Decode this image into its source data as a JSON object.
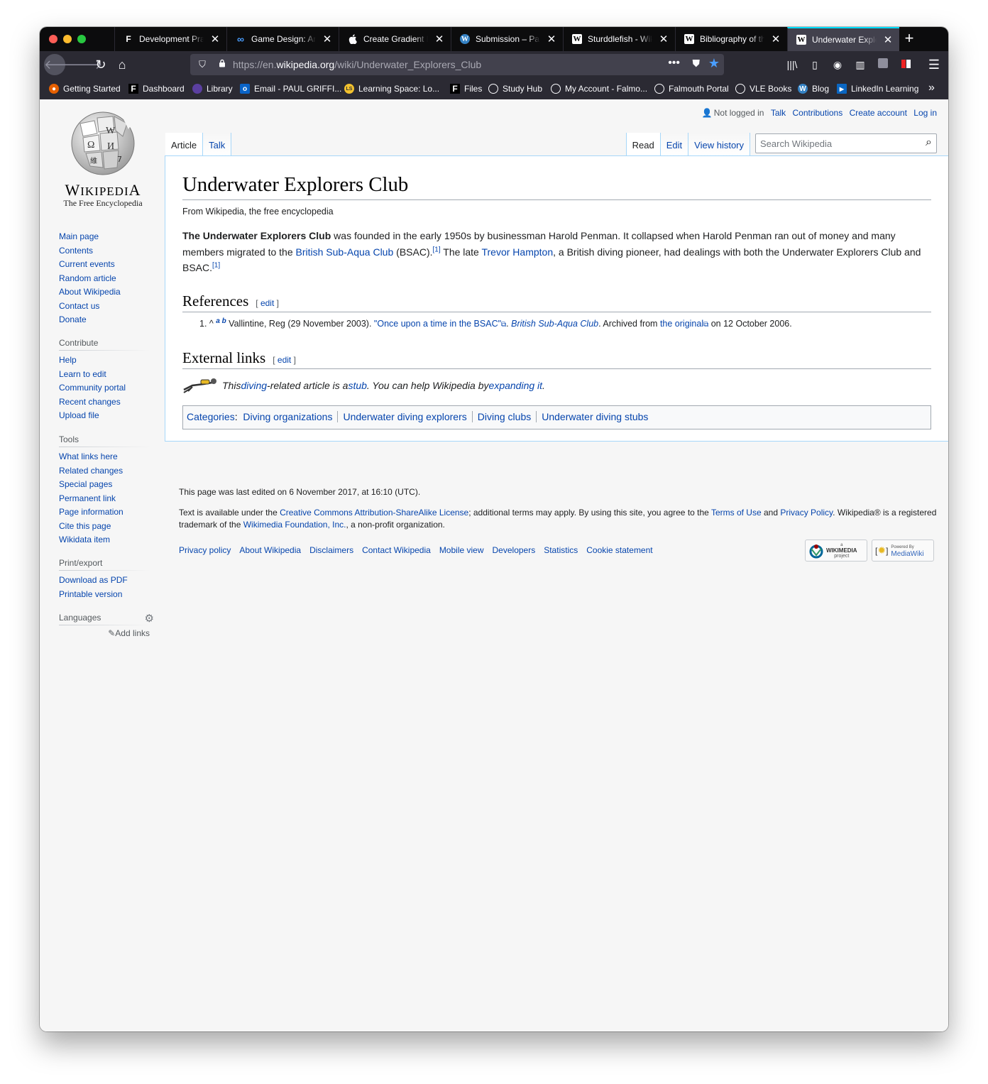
{
  "browser": {
    "tabs": [
      {
        "label": "Development Practice",
        "icon": "falmouth-f-icon"
      },
      {
        "label": "Game Design: Art & Concept",
        "icon": "infinity-icon"
      },
      {
        "label": "Create Gradient Fills",
        "icon": "apple-icon"
      },
      {
        "label": "Submission – Paul",
        "icon": "wordpress-icon"
      },
      {
        "label": "Sturddlefish - Wiki",
        "icon": "wikipedia-w-icon"
      },
      {
        "label": "Bibliography of the",
        "icon": "wikipedia-w-icon"
      },
      {
        "label": "Underwater Explorers",
        "icon": "wikipedia-w-icon",
        "active": true
      }
    ],
    "url_prefix": "https://en.",
    "url_domain": "wikipedia.org",
    "url_path": "/wiki/Underwater_Explorers_Club",
    "bookmarks": [
      {
        "label": "Getting Started",
        "icon": "firefox-icon",
        "color": "#e66000"
      },
      {
        "label": "Dashboard",
        "icon": "falmouth-f-icon",
        "color": "#000000"
      },
      {
        "label": "Library",
        "icon": "library-icon",
        "color": "#5b3fa0"
      },
      {
        "label": "Email - PAUL GRIFFI...",
        "icon": "outlook-icon",
        "color": "#0a64c8"
      },
      {
        "label": "Learning Space: Lo...",
        "icon": "ls-icon",
        "color": "#f2c12e"
      },
      {
        "label": "Files",
        "icon": "falmouth-f-icon",
        "color": "#000000"
      },
      {
        "label": "Study Hub",
        "icon": "globe-icon",
        "color": "#2b2a33"
      },
      {
        "label": "My Account - Falmo...",
        "icon": "globe-icon",
        "color": "#2b2a33"
      },
      {
        "label": "Falmouth Portal",
        "icon": "globe-icon",
        "color": "#2b2a33"
      },
      {
        "label": "VLE Books",
        "icon": "globe-icon",
        "color": "#2b2a33"
      },
      {
        "label": "Blog",
        "icon": "wordpress-icon",
        "color": "#3582c4"
      },
      {
        "label": "LinkedIn Learning",
        "icon": "linkedin-learning-icon",
        "color": "#0a66c2"
      }
    ]
  },
  "logo": {
    "wordmark": "Wikipedia",
    "tagline": "The Free Encyclopedia"
  },
  "sidebar": {
    "navigation": [
      "Main page",
      "Contents",
      "Current events",
      "Random article",
      "About Wikipedia",
      "Contact us",
      "Donate"
    ],
    "contribute": {
      "heading": "Contribute",
      "items": [
        "Help",
        "Learn to edit",
        "Community portal",
        "Recent changes",
        "Upload file"
      ]
    },
    "tools": {
      "heading": "Tools",
      "items": [
        "What links here",
        "Related changes",
        "Special pages",
        "Permanent link",
        "Page information",
        "Cite this page",
        "Wikidata item"
      ]
    },
    "print": {
      "heading": "Print/export",
      "items": [
        "Download as PDF",
        "Printable version"
      ]
    },
    "languages": {
      "heading": "Languages",
      "add_links": "Add links"
    }
  },
  "personal": {
    "not_logged_in": "Not logged in",
    "talk": "Talk",
    "contributions": "Contributions",
    "create_account": "Create account",
    "log_in": "Log in"
  },
  "tabs": {
    "article": "Article",
    "talk": "Talk",
    "read": "Read",
    "edit": "Edit",
    "view_history": "View history"
  },
  "search": {
    "placeholder": "Search Wikipedia"
  },
  "article": {
    "title": "Underwater Explorers Club",
    "site_sub": "From Wikipedia, the free encyclopedia",
    "p_bold": "The Underwater Explorers Club",
    "p_t1": " was founded in the early 1950s by businessman Harold Penman. It collapsed when Harold Penman ran out of money and many members migrated to the ",
    "p_link1": "British Sub-Aqua Club",
    "p_t2": " (BSAC).",
    "p_sup1": "[1]",
    "p_t3": " The late ",
    "p_link2": "Trevor Hampton",
    "p_t4": ", a British diving pioneer, had dealings with both the Underwater Explorers Club and BSAC.",
    "p_sup2": "[1]",
    "references_heading": "References",
    "edit_label": "edit",
    "ref_num": "1. ^",
    "ref_ab": "a b",
    "ref_author": " Vallintine, Reg (29 November 2003). ",
    "ref_title": "\"Once upon a time in the BSAC\"",
    "ref_dot": ". ",
    "ref_pub": "British Sub-Aqua Club",
    "ref_archived": ". Archived from ",
    "ref_original": "the original",
    "ref_date": " on 12 October 2006.",
    "external_heading": "External links",
    "stub_t1": "This ",
    "stub_l1": "diving",
    "stub_t2": "-related article is a ",
    "stub_l2": "stub",
    "stub_t3": ". You can help Wikipedia by ",
    "stub_l3": "expanding it",
    "stub_t4": ".",
    "categories_label": "Categories",
    "categories": [
      "Diving organizations",
      "Underwater diving explorers",
      "Diving clubs",
      "Underwater diving stubs"
    ]
  },
  "footer": {
    "last_edited": "This page was last edited on 6 November 2017, at 16:10 (UTC).",
    "lic_t1": "Text is available under the ",
    "lic_l1": "Creative Commons Attribution-ShareAlike License",
    "lic_t2": "; additional terms may apply. By using this site, you agree to the ",
    "lic_l2": "Terms of Use",
    "lic_t3": " and ",
    "lic_l3": "Privacy Policy",
    "lic_t4": ". Wikipedia® is a registered trademark of the ",
    "lic_l4": "Wikimedia Foundation, Inc.",
    "lic_t5": ", a non-profit organization.",
    "places": [
      "Privacy policy",
      "About Wikipedia",
      "Disclaimers",
      "Contact Wikipedia",
      "Mobile view",
      "Developers",
      "Statistics",
      "Cookie statement"
    ],
    "badge1": {
      "top": "a",
      "main": "WIKIMEDIA",
      "sub": "project"
    },
    "badge2": {
      "top": "Powered By",
      "main": "MediaWiki"
    }
  },
  "colors": {
    "link": "#0645ad",
    "tab_accent": "#00ddff",
    "star": "#4a9eff"
  }
}
